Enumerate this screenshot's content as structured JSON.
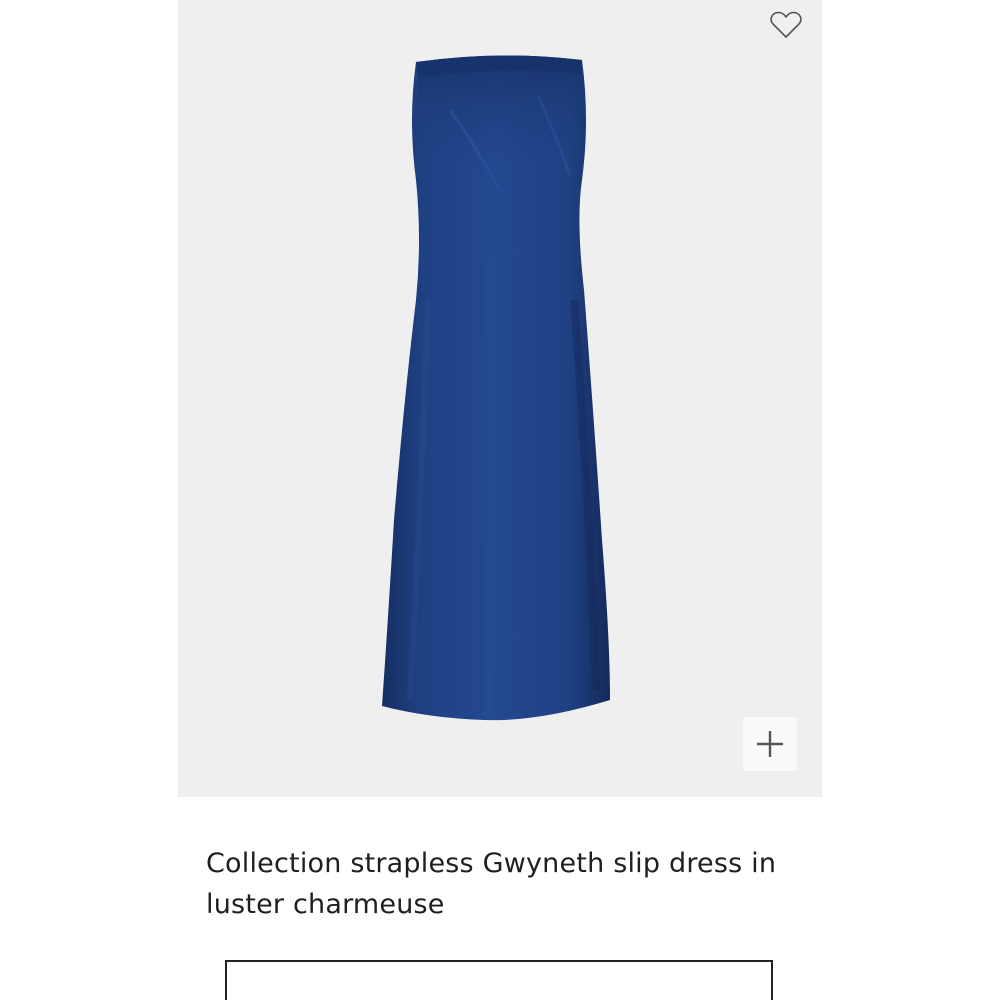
{
  "product": {
    "title": "Collection strapless Gwyneth slip dress in luster charmeuse",
    "image": {
      "subject": "strapless slip dress",
      "dress_color": "#1e3f7f",
      "background_color": "#efefef"
    }
  },
  "icons": {
    "wishlist": "heart-outline-icon",
    "quick_add": "plus-icon"
  },
  "colors": {
    "text": "#1f1f1f",
    "icon": "#555555",
    "border": "#222222"
  }
}
